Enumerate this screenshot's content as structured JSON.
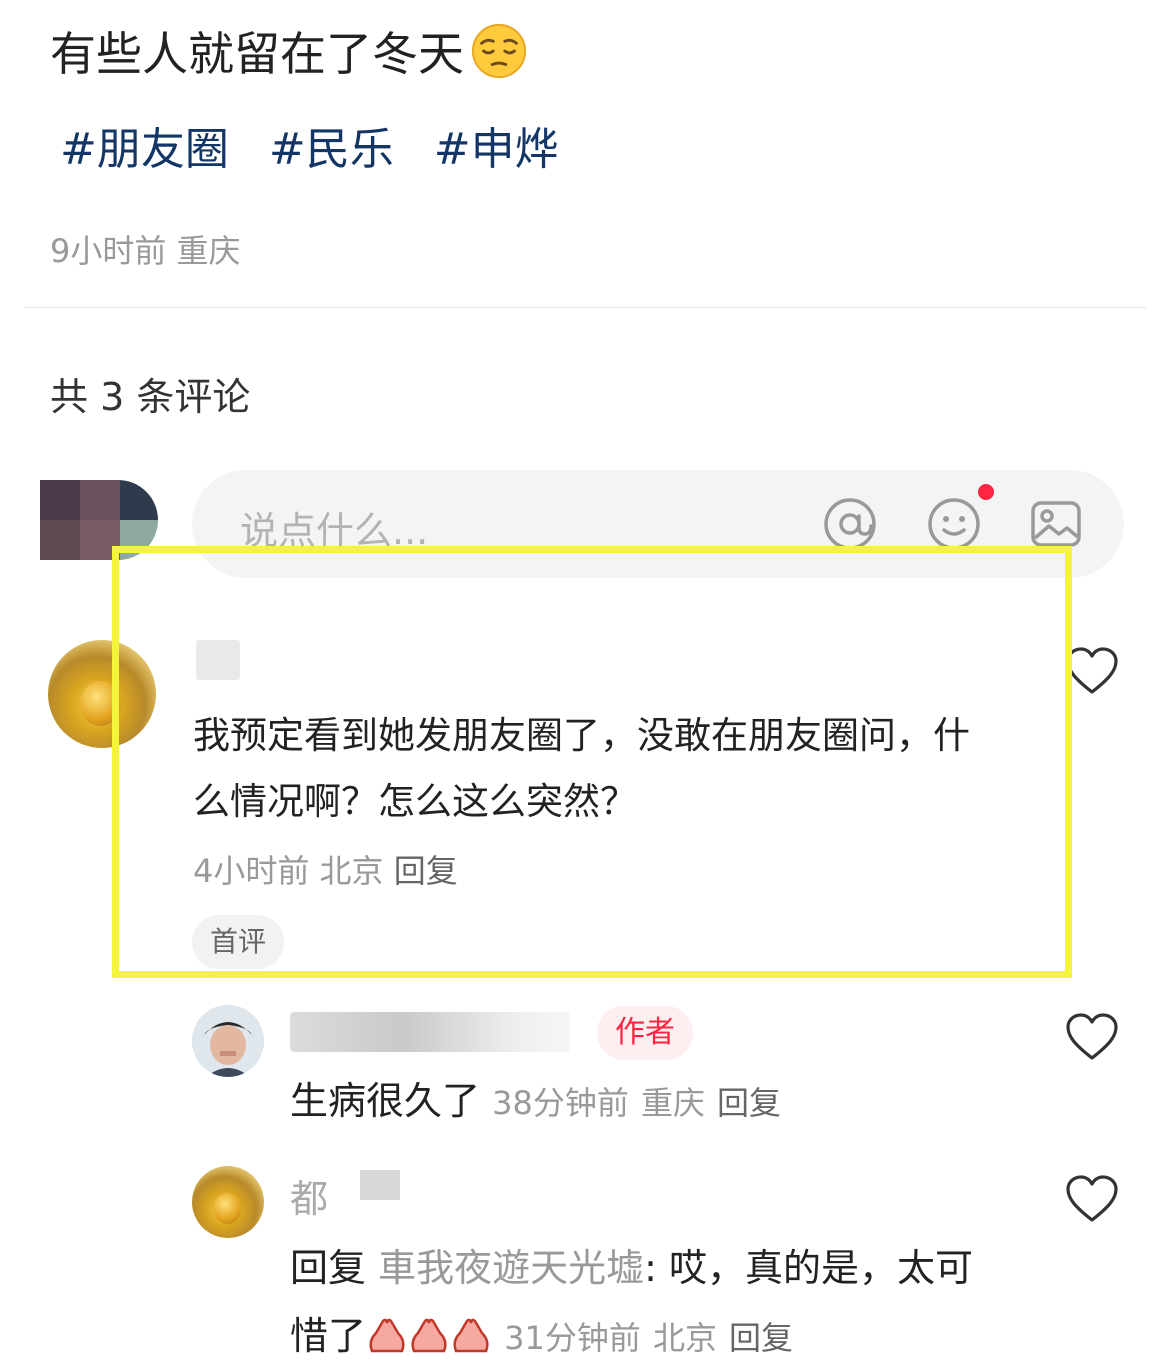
{
  "post": {
    "title": "有些人就留在了冬天",
    "title_emoji": "pensive-face",
    "tags": [
      "#朋友圈",
      "#民乐",
      "#申烨"
    ],
    "time": "9小时前",
    "location": "重庆"
  },
  "comments_header": {
    "count_text": "共 3 条评论"
  },
  "input": {
    "placeholder": "说点什么...",
    "icons": [
      "at-icon",
      "emoji-icon",
      "image-icon"
    ],
    "emoji_has_notification": true
  },
  "comments": [
    {
      "text": "我预定看到她发朋友圈了，没敢在朋友圈问，什么情况啊？怎么这么突然？",
      "time": "4小时前",
      "location": "北京",
      "reply_label": "回复",
      "badge": "首评",
      "replies": [
        {
          "author_badge": "作者",
          "text": "生病很久了",
          "time": "38分钟前",
          "location": "重庆",
          "reply_label": "回复"
        },
        {
          "name_visible": "都",
          "reply_prefix": "回复",
          "reply_to": "車我夜遊天光墟",
          "text": ": 哎，真的是，太可惜了",
          "emoji": "folded-hands",
          "emoji_count": 3,
          "time": "31分钟前",
          "location": "北京",
          "reply_label": "回复"
        }
      ]
    }
  ],
  "colors": {
    "tag": "#133667",
    "accent_red": "#ff2442",
    "muted_text": "#999999",
    "highlight_box": "#f4f53a"
  }
}
